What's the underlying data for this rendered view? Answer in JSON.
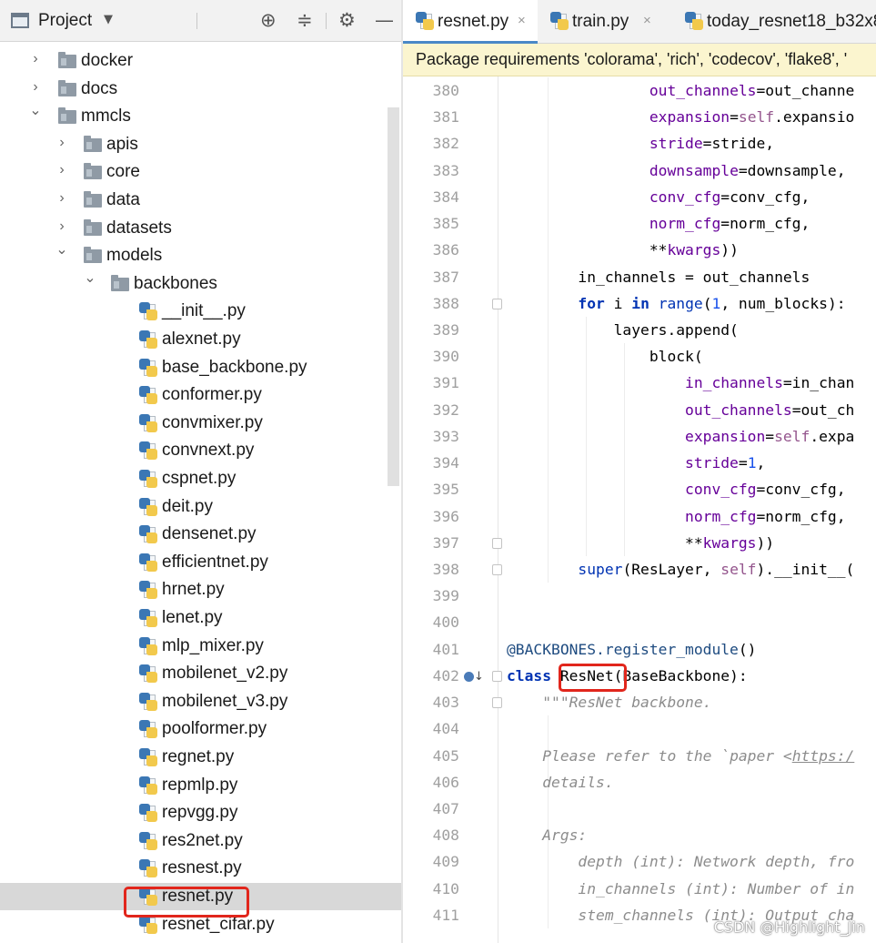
{
  "project_panel": {
    "title": "Project",
    "caret": "▼",
    "icons": {
      "locate": "crosshair-icon",
      "collapse": "collapse-all-icon",
      "settings": "gear-icon",
      "hide": "minimize-icon"
    },
    "tree": [
      {
        "label": "docker",
        "type": "folder",
        "depth": 0,
        "expanded": false
      },
      {
        "label": "docs",
        "type": "folder",
        "depth": 0,
        "expanded": false
      },
      {
        "label": "mmcls",
        "type": "folder",
        "depth": 0,
        "expanded": true
      },
      {
        "label": "apis",
        "type": "folder",
        "depth": 1,
        "expanded": false
      },
      {
        "label": "core",
        "type": "folder",
        "depth": 1,
        "expanded": false
      },
      {
        "label": "data",
        "type": "folder",
        "depth": 1,
        "expanded": false
      },
      {
        "label": "datasets",
        "type": "folder",
        "depth": 1,
        "expanded": false
      },
      {
        "label": "models",
        "type": "folder",
        "depth": 1,
        "expanded": true
      },
      {
        "label": "backbones",
        "type": "folder",
        "depth": 2,
        "expanded": true
      },
      {
        "label": "__init__.py",
        "type": "file",
        "depth": 3
      },
      {
        "label": "alexnet.py",
        "type": "file",
        "depth": 3
      },
      {
        "label": "base_backbone.py",
        "type": "file",
        "depth": 3
      },
      {
        "label": "conformer.py",
        "type": "file",
        "depth": 3
      },
      {
        "label": "convmixer.py",
        "type": "file",
        "depth": 3
      },
      {
        "label": "convnext.py",
        "type": "file",
        "depth": 3
      },
      {
        "label": "cspnet.py",
        "type": "file",
        "depth": 3
      },
      {
        "label": "deit.py",
        "type": "file",
        "depth": 3
      },
      {
        "label": "densenet.py",
        "type": "file",
        "depth": 3
      },
      {
        "label": "efficientnet.py",
        "type": "file",
        "depth": 3
      },
      {
        "label": "hrnet.py",
        "type": "file",
        "depth": 3
      },
      {
        "label": "lenet.py",
        "type": "file",
        "depth": 3
      },
      {
        "label": "mlp_mixer.py",
        "type": "file",
        "depth": 3
      },
      {
        "label": "mobilenet_v2.py",
        "type": "file",
        "depth": 3
      },
      {
        "label": "mobilenet_v3.py",
        "type": "file",
        "depth": 3
      },
      {
        "label": "poolformer.py",
        "type": "file",
        "depth": 3
      },
      {
        "label": "regnet.py",
        "type": "file",
        "depth": 3
      },
      {
        "label": "repmlp.py",
        "type": "file",
        "depth": 3
      },
      {
        "label": "repvgg.py",
        "type": "file",
        "depth": 3
      },
      {
        "label": "res2net.py",
        "type": "file",
        "depth": 3
      },
      {
        "label": "resnest.py",
        "type": "file",
        "depth": 3
      },
      {
        "label": "resnet.py",
        "type": "file",
        "depth": 3,
        "selected": true
      },
      {
        "label": "resnet_cifar.py",
        "type": "file",
        "depth": 3
      }
    ]
  },
  "editor": {
    "tabs": [
      {
        "label": "resnet.py",
        "active": true,
        "close": "×"
      },
      {
        "label": "train.py",
        "active": false,
        "close": "×"
      },
      {
        "label": "today_resnet18_b32x8_",
        "active": false,
        "close": ""
      }
    ],
    "notification": "Package requirements 'colorama', 'rich', 'codecov', 'flake8', '",
    "lines": [
      {
        "n": "380",
        "html": "                <span class=\"prm\">out_channels</span>=out_channe"
      },
      {
        "n": "381",
        "html": "                <span class=\"prm\">expansion</span>=<span class=\"sf\">self</span>.expansio"
      },
      {
        "n": "382",
        "html": "                <span class=\"prm\">stride</span>=stride,"
      },
      {
        "n": "383",
        "html": "                <span class=\"prm\">downsample</span>=downsample,"
      },
      {
        "n": "384",
        "html": "                <span class=\"prm\">conv_cfg</span>=conv_cfg,"
      },
      {
        "n": "385",
        "html": "                <span class=\"prm\">norm_cfg</span>=norm_cfg,"
      },
      {
        "n": "386",
        "html": "                **<span class=\"prm\">kwargs</span>))"
      },
      {
        "n": "387",
        "html": "        in_channels = out_channels"
      },
      {
        "n": "388",
        "html": "        <span class=\"kw\">for</span> i <span class=\"kw\">in</span> <span class=\"fn\">range</span>(<span class=\"num\">1</span>, num_blocks):"
      },
      {
        "n": "389",
        "html": "            layers.append("
      },
      {
        "n": "390",
        "html": "                block("
      },
      {
        "n": "391",
        "html": "                    <span class=\"prm\">in_channels</span>=in_chan"
      },
      {
        "n": "392",
        "html": "                    <span class=\"prm\">out_channels</span>=out_ch"
      },
      {
        "n": "393",
        "html": "                    <span class=\"prm\">expansion</span>=<span class=\"sf\">self</span>.expa"
      },
      {
        "n": "394",
        "html": "                    <span class=\"prm\">stride</span>=<span class=\"num\">1</span>,"
      },
      {
        "n": "395",
        "html": "                    <span class=\"prm\">conv_cfg</span>=conv_cfg,"
      },
      {
        "n": "396",
        "html": "                    <span class=\"prm\">norm_cfg</span>=norm_cfg,"
      },
      {
        "n": "397",
        "html": "                    **<span class=\"prm\">kwargs</span>))"
      },
      {
        "n": "398",
        "html": "        <span class=\"fn\">super</span>(ResLayer, <span class=\"sf\">self</span>).__init__("
      },
      {
        "n": "399",
        "html": ""
      },
      {
        "n": "400",
        "html": ""
      },
      {
        "n": "401",
        "html": "<span class=\"dec\">@BACKBONES.register_module</span>()"
      },
      {
        "n": "402",
        "html": "<span class=\"kw\">class</span> ResNet(BaseBackbone):"
      },
      {
        "n": "403",
        "html": "    <span class=\"doc\">\"\"\"ResNet backbone.</span>"
      },
      {
        "n": "404",
        "html": ""
      },
      {
        "n": "405",
        "html": "    <span class=\"doc\">Please refer to the `paper &lt;</span><span class=\"lnk\">https:/</span>"
      },
      {
        "n": "406",
        "html": "    <span class=\"doc\">details.</span>"
      },
      {
        "n": "407",
        "html": ""
      },
      {
        "n": "408",
        "html": "    <span class=\"doc\">Args:</span>"
      },
      {
        "n": "409",
        "html": "        <span class=\"doc\">depth (int): Network depth, fro</span>"
      },
      {
        "n": "410",
        "html": "        <span class=\"doc\">in_channels (int): Number of in</span>"
      },
      {
        "n": "411",
        "html": "        <span class=\"doc\">stem_channels (int): Output cha</span>"
      }
    ],
    "fold_markers": [
      "388",
      "397",
      "398",
      "402",
      "403"
    ],
    "gutter_icon_line": "402",
    "gutter_icon": "implements-icon"
  },
  "watermark": "CSDN @Highlight_Jin",
  "colors": {
    "highlight_box": "#e1261c",
    "notification_bg": "#fbf5cf",
    "keyword": "#0033b3",
    "param": "#660099"
  }
}
